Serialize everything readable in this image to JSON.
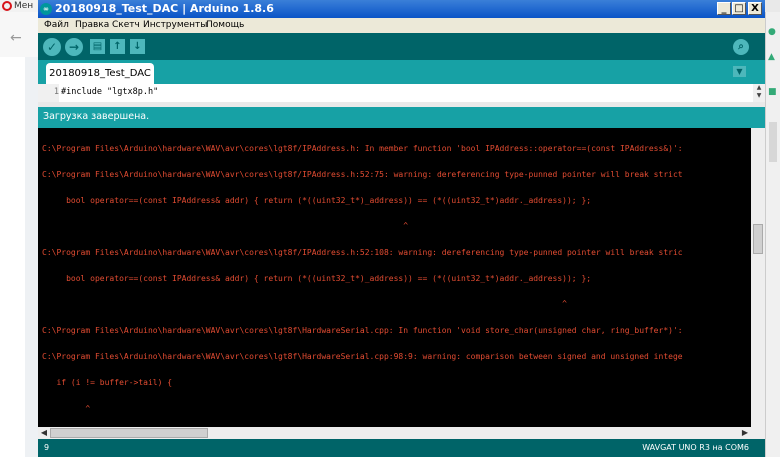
{
  "background": {
    "tab_label": "Мен",
    "back_symbol": "←"
  },
  "window": {
    "title": "20180918_Test_DAC | Arduino 1.8.6",
    "logo": "∞",
    "minimize_symbol": "_",
    "maximize_symbol": "□",
    "close_symbol": "X"
  },
  "menu": {
    "file": "Файл",
    "edit": "Правка",
    "sketch": "Скетч",
    "tools": "Инструменты",
    "help": "Помощь"
  },
  "toolbar": {
    "verify_icon": "check-icon",
    "upload_icon": "arrow-right-icon",
    "new_icon": "new-file-icon",
    "open_icon": "arrow-up-icon",
    "save_icon": "arrow-down-icon",
    "serial_monitor_icon": "magnifier-icon"
  },
  "tabs": [
    {
      "label": "20180918_Test_DAC"
    }
  ],
  "editor": {
    "line_number": "1",
    "code": "#include \"lgtx8p.h\""
  },
  "status_message": "Загрузка завершена.",
  "console_lines": [
    "C:\\Program Files\\Arduino\\hardware\\WAV\\avr\\cores\\lgt8f/IPAddress.h: In member function 'bool IPAddress::operator==(const IPAddress&)':",
    "C:\\Program Files\\Arduino\\hardware\\WAV\\avr\\cores\\lgt8f/IPAddress.h:52:75: warning: dereferencing type-punned pointer will break strict",
    "     bool operator==(const IPAddress& addr) { return (*((uint32_t*)_address)) == (*((uint32_t*)addr._address)); };",
    "                                                                           ^",
    "C:\\Program Files\\Arduino\\hardware\\WAV\\avr\\cores\\lgt8f/IPAddress.h:52:108: warning: dereferencing type-punned pointer will break stric",
    "     bool operator==(const IPAddress& addr) { return (*((uint32_t*)_address)) == (*((uint32_t*)addr._address)); };",
    "                                                                                                            ^",
    "C:\\Program Files\\Arduino\\hardware\\WAV\\avr\\cores\\lgt8f\\HardwareSerial.cpp: In function 'void store_char(unsigned char, ring_buffer*)':",
    "C:\\Program Files\\Arduino\\hardware\\WAV\\avr\\cores\\lgt8f\\HardwareSerial.cpp:98:9: warning: comparison between signed and unsigned intege",
    "   if (i != buffer->tail) {",
    "         ^"
  ],
  "footer": {
    "line": "9",
    "board": "WAVGAT UNO R3 на COM6"
  },
  "colors": {
    "teal_dark": "#006468",
    "teal_light": "#17a1a5",
    "console_text": "#e34c32"
  }
}
